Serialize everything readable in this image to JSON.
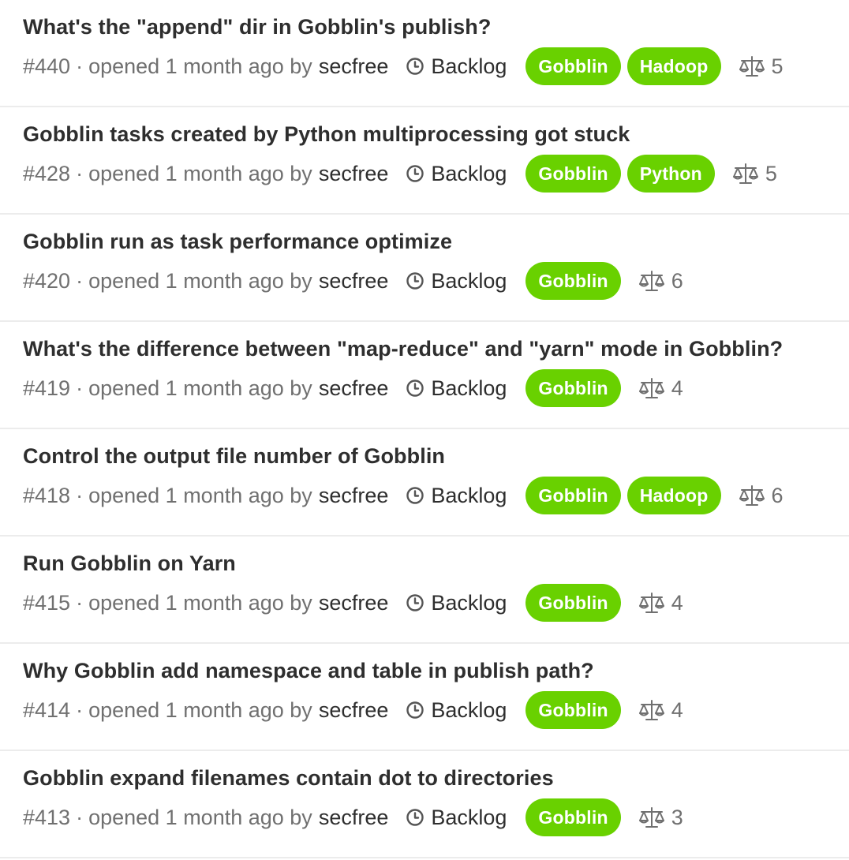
{
  "issues": [
    {
      "title": "What's the \"append\" dir in Gobblin's publish?",
      "ref": "#440",
      "opened_text": "opened 1 month ago by",
      "author": "secfree",
      "milestone": "Backlog",
      "labels": [
        "Gobblin",
        "Hadoop"
      ],
      "weight": "5"
    },
    {
      "title": "Gobblin tasks created by Python multiprocessing got stuck",
      "ref": "#428",
      "opened_text": "opened 1 month ago by",
      "author": "secfree",
      "milestone": "Backlog",
      "labels": [
        "Gobblin",
        "Python"
      ],
      "weight": "5"
    },
    {
      "title": "Gobblin run as task performance optimize",
      "ref": "#420",
      "opened_text": "opened 1 month ago by",
      "author": "secfree",
      "milestone": "Backlog",
      "labels": [
        "Gobblin"
      ],
      "weight": "6"
    },
    {
      "title": "What's the difference between \"map-reduce\" and \"yarn\" mode in Gobblin?",
      "ref": "#419",
      "opened_text": "opened 1 month ago by",
      "author": "secfree",
      "milestone": "Backlog",
      "labels": [
        "Gobblin"
      ],
      "weight": "4"
    },
    {
      "title": "Control the output file number of Gobblin",
      "ref": "#418",
      "opened_text": "opened 1 month ago by",
      "author": "secfree",
      "milestone": "Backlog",
      "labels": [
        "Gobblin",
        "Hadoop"
      ],
      "weight": "6"
    },
    {
      "title": "Run Gobblin on Yarn",
      "ref": "#415",
      "opened_text": "opened 1 month ago by",
      "author": "secfree",
      "milestone": "Backlog",
      "labels": [
        "Gobblin"
      ],
      "weight": "4"
    },
    {
      "title": "Why Gobblin add namespace and table in publish path?",
      "ref": "#414",
      "opened_text": "opened 1 month ago by",
      "author": "secfree",
      "milestone": "Backlog",
      "labels": [
        "Gobblin"
      ],
      "weight": "4"
    },
    {
      "title": "Gobblin expand filenames contain dot to directories",
      "ref": "#413",
      "opened_text": "opened 1 month ago by",
      "author": "secfree",
      "milestone": "Backlog",
      "labels": [
        "Gobblin"
      ],
      "weight": "3"
    }
  ],
  "separator": "·",
  "icons": {
    "milestone": "clock-icon",
    "weight": "scale-icon"
  },
  "colors": {
    "label_bg": "#69d100",
    "label_text": "#ffffff",
    "title_text": "#2e2e2e",
    "meta_text": "#707070"
  }
}
